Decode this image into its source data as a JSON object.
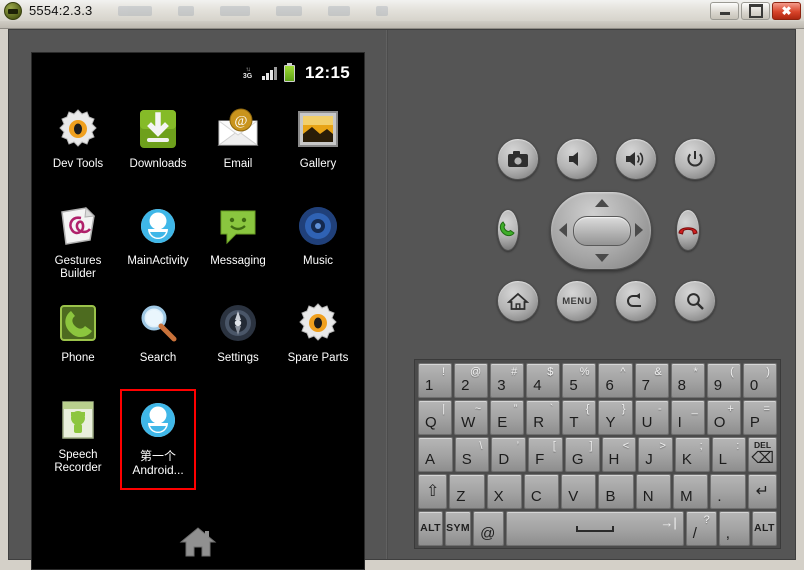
{
  "window": {
    "title": "5554:2.3.3",
    "icon": "android-emulator-icon",
    "buttons": {
      "minimize": "minimize-button",
      "maximize": "maximize-button",
      "close": "✖"
    }
  },
  "device": {
    "statusbar": {
      "network_label": "3G",
      "network_arrows": "↑↓",
      "signal_icon": "signal-bars-icon",
      "battery_icon": "battery-icon",
      "clock": "12:15"
    },
    "apps": [
      {
        "label": "Dev Tools",
        "icon": "dev-tools-icon",
        "highlighted": false
      },
      {
        "label": "Downloads",
        "icon": "downloads-icon",
        "highlighted": false
      },
      {
        "label": "Email",
        "icon": "email-icon",
        "highlighted": false
      },
      {
        "label": "Gallery",
        "icon": "gallery-icon",
        "highlighted": false
      },
      {
        "label": "Gestures Builder",
        "icon": "gestures-builder-icon",
        "highlighted": false
      },
      {
        "label": "MainActivity",
        "icon": "main-activity-icon",
        "highlighted": false
      },
      {
        "label": "Messaging",
        "icon": "messaging-icon",
        "highlighted": false
      },
      {
        "label": "Music",
        "icon": "music-icon",
        "highlighted": false
      },
      {
        "label": "Phone",
        "icon": "phone-icon",
        "highlighted": false
      },
      {
        "label": "Search",
        "icon": "search-icon",
        "highlighted": false
      },
      {
        "label": "Settings",
        "icon": "settings-icon",
        "highlighted": false
      },
      {
        "label": "Spare Parts",
        "icon": "spare-parts-icon",
        "highlighted": false
      },
      {
        "label": "Speech Recorder",
        "icon": "speech-recorder-icon",
        "highlighted": false
      },
      {
        "label": "第一个Android...",
        "icon": "first-android-app-icon",
        "highlighted": true
      }
    ],
    "dock": {
      "home_icon": "home-icon"
    },
    "highlight_color": "#ff0000"
  },
  "controls": {
    "row1": [
      {
        "name": "camera-button",
        "glyph": "📷"
      },
      {
        "name": "volume-down-button",
        "glyph": "🔈"
      },
      {
        "name": "volume-up-button",
        "glyph": "🔊"
      },
      {
        "name": "power-button",
        "glyph": "⏻"
      }
    ],
    "call_row": {
      "call_button": "📞",
      "end_call_button": "📞",
      "dpad": {
        "up": "dpad-up",
        "down": "dpad-down",
        "left": "dpad-left",
        "right": "dpad-right",
        "center": "dpad-center"
      }
    },
    "row3": [
      {
        "name": "home-button",
        "glyph": "⌂"
      },
      {
        "name": "menu-button",
        "glyph": "MENU"
      },
      {
        "name": "back-button",
        "glyph": "↶"
      },
      {
        "name": "search-button",
        "glyph": "⚲"
      }
    ],
    "led_indicator": "#e01818"
  },
  "keyboard": {
    "rows": [
      [
        {
          "main": "1",
          "sup": "!"
        },
        {
          "main": "2",
          "sup": "@"
        },
        {
          "main": "3",
          "sup": "#"
        },
        {
          "main": "4",
          "sup": "$"
        },
        {
          "main": "5",
          "sup": "%"
        },
        {
          "main": "6",
          "sup": "^"
        },
        {
          "main": "7",
          "sup": "&"
        },
        {
          "main": "8",
          "sup": "*"
        },
        {
          "main": "9",
          "sup": "("
        },
        {
          "main": "0",
          "sup": ")"
        }
      ],
      [
        {
          "main": "Q",
          "sup": "|"
        },
        {
          "main": "W",
          "sup": "~"
        },
        {
          "main": "E",
          "sup": "”"
        },
        {
          "main": "R",
          "sup": "`"
        },
        {
          "main": "T",
          "sup": "{"
        },
        {
          "main": "Y",
          "sup": "}"
        },
        {
          "main": "U",
          "sup": "-"
        },
        {
          "main": "I",
          "sup": "_"
        },
        {
          "main": "O",
          "sup": "+"
        },
        {
          "main": "P",
          "sup": "="
        }
      ],
      [
        {
          "main": "A",
          "sup": ""
        },
        {
          "main": "S",
          "sup": "\\"
        },
        {
          "main": "D",
          "sup": "’"
        },
        {
          "main": "F",
          "sup": "["
        },
        {
          "main": "G",
          "sup": "]"
        },
        {
          "main": "H",
          "sup": "<"
        },
        {
          "main": "J",
          "sup": ">"
        },
        {
          "main": "K",
          "sup": ";"
        },
        {
          "main": "L",
          "sup": ":"
        },
        {
          "main": "DEL",
          "sup": "",
          "type": "del"
        }
      ],
      [
        {
          "main": "⇧",
          "sup": "",
          "type": "shift"
        },
        {
          "main": "Z",
          "sup": ""
        },
        {
          "main": "X",
          "sup": ""
        },
        {
          "main": "C",
          "sup": ""
        },
        {
          "main": "V",
          "sup": ""
        },
        {
          "main": "B",
          "sup": ""
        },
        {
          "main": "N",
          "sup": ""
        },
        {
          "main": "M",
          "sup": ""
        },
        {
          "main": ".",
          "sup": ""
        },
        {
          "main": "↵",
          "sup": "",
          "type": "enter"
        }
      ],
      [
        {
          "main": "ALT",
          "sup": "",
          "type": "ctrl"
        },
        {
          "main": "SYM",
          "sup": "",
          "type": "ctrl"
        },
        {
          "main": "@",
          "sup": ""
        },
        {
          "main": "",
          "sup": "→|",
          "type": "space"
        },
        {
          "main": "/",
          "sup": "?"
        },
        {
          "main": ",",
          "sup": ""
        },
        {
          "main": "ALT",
          "sup": "",
          "type": "ctrl"
        }
      ]
    ]
  }
}
